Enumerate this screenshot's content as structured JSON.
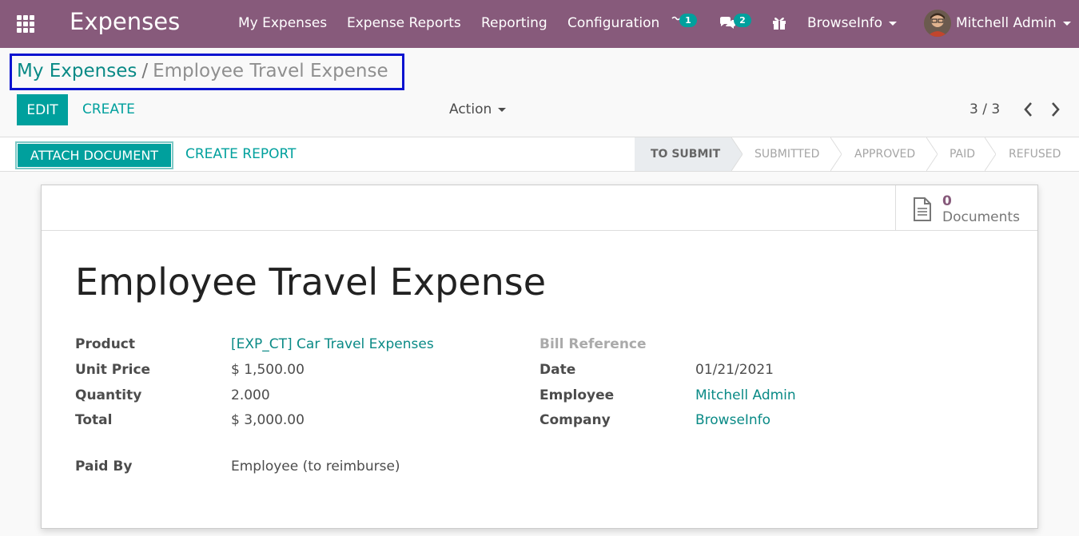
{
  "navbar": {
    "app_title": "Expenses",
    "menu": [
      "My Expenses",
      "Expense Reports",
      "Reporting",
      "Configuration"
    ],
    "activity_count": "1",
    "messages_count": "2",
    "company": "BrowseInfo",
    "user": "Mitchell Admin"
  },
  "breadcrumb": {
    "parent": "My Expenses",
    "separator": "/",
    "current": "Employee Travel Expense"
  },
  "control": {
    "edit_label": "EDIT",
    "create_label": "CREATE",
    "action_label": "Action",
    "pager": "3 / 3"
  },
  "statusbar": {
    "attach_label": "ATTACH DOCUMENT",
    "report_label": "CREATE REPORT",
    "stages": [
      "TO SUBMIT",
      "SUBMITTED",
      "APPROVED",
      "PAID",
      "REFUSED"
    ],
    "active_stage": "TO SUBMIT"
  },
  "documents": {
    "count": "0",
    "label": "Documents"
  },
  "form": {
    "title": "Employee Travel Expense",
    "left": [
      {
        "label": "Product",
        "value": "[EXP_CT] Car Travel Expenses"
      },
      {
        "label": "Unit Price",
        "value": "$ 1,500.00"
      },
      {
        "label": "Quantity",
        "value": "2.000"
      },
      {
        "label": "Total",
        "value": "$ 3,000.00"
      }
    ],
    "right": [
      {
        "label": "Bill Reference",
        "value": ""
      },
      {
        "label": "Date",
        "value": "01/21/2021"
      },
      {
        "label": "Employee",
        "value": "Mitchell Admin"
      },
      {
        "label": "Company",
        "value": "BrowseInfo"
      }
    ],
    "paid_by": {
      "label": "Paid By",
      "value": "Employee (to reimburse)"
    }
  },
  "colors": {
    "navbar": "#875a7b",
    "primary": "#00a09d",
    "link": "#0a8a86",
    "highlight_border": "#0b13d0"
  },
  "icons": [
    "apps-grid-icon",
    "activity-clock-icon",
    "chat-icon",
    "gift-icon",
    "chevron-left-icon",
    "chevron-right-icon",
    "document-icon"
  ]
}
